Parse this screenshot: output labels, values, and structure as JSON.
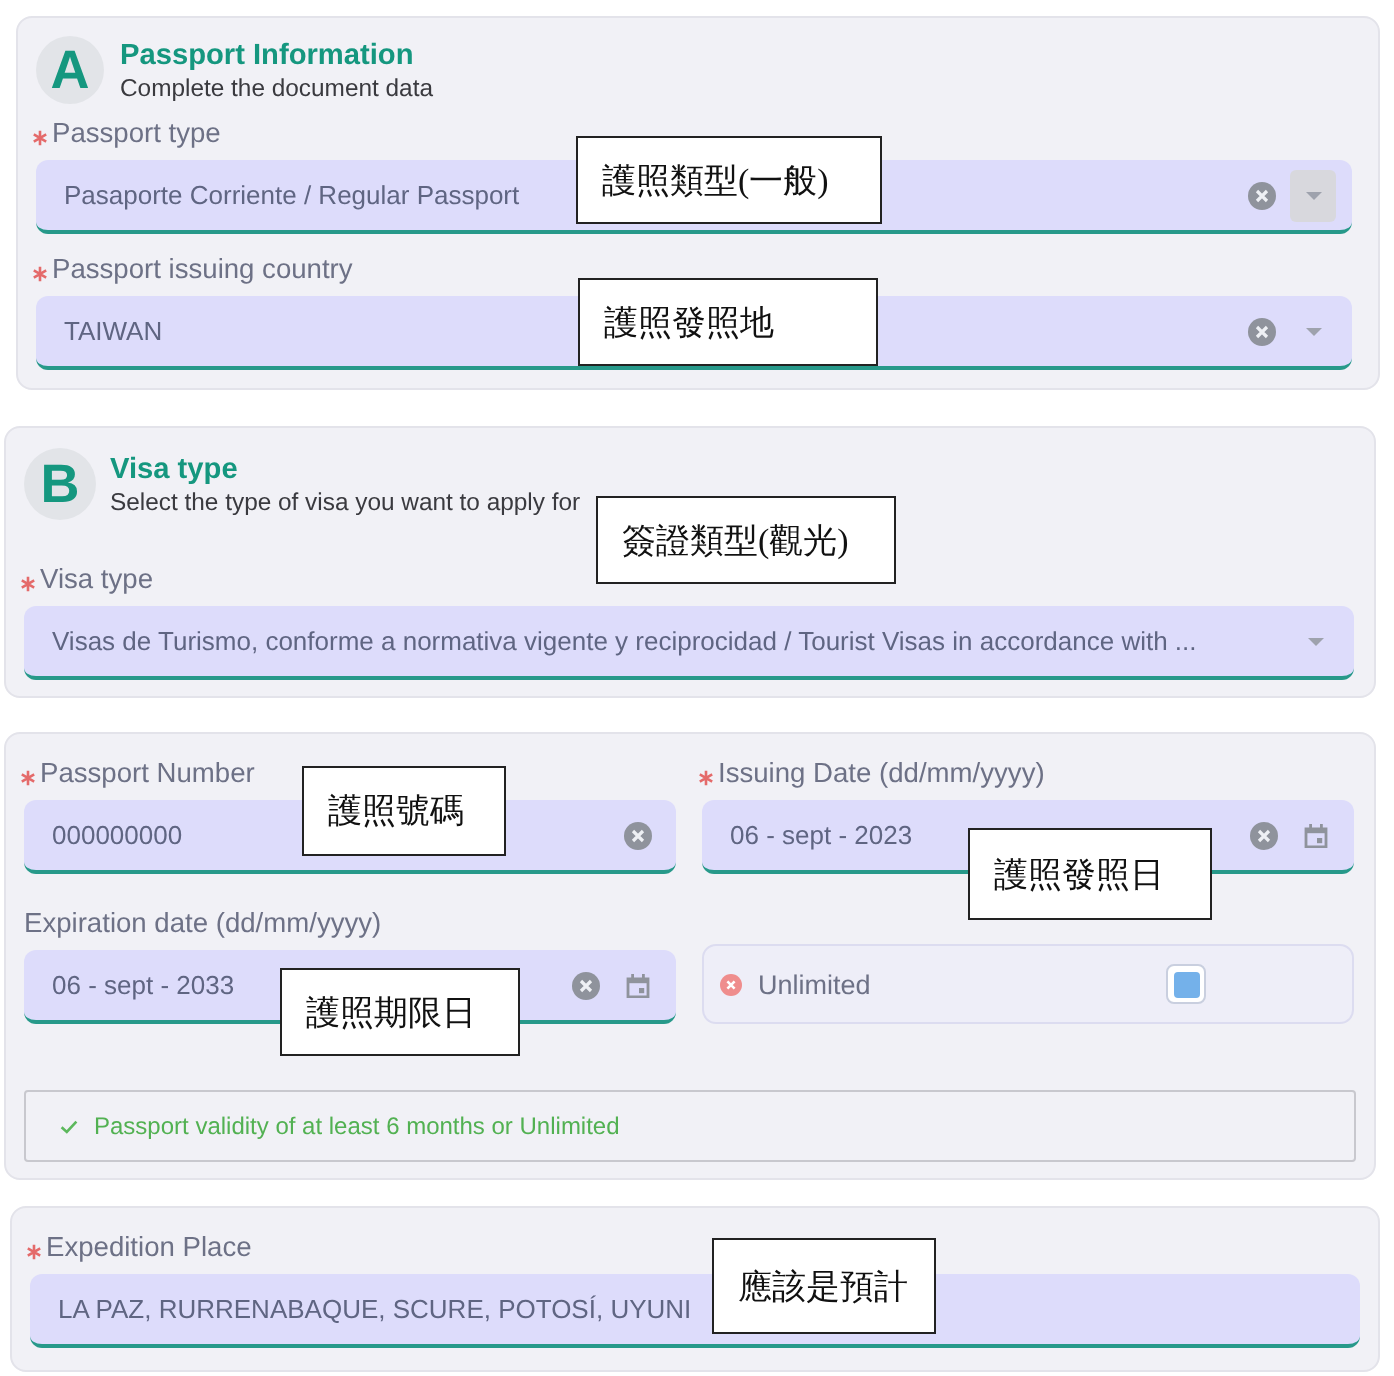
{
  "sections": [
    {
      "kind": "intro",
      "badge": "A",
      "title": "Passport Information",
      "subtitle": "Complete the document data",
      "fields": [
        {
          "kind": "select",
          "label": "Passport type",
          "required": true,
          "value": "Pasaporte Corriente / Regular Passport",
          "clearable": true,
          "caret_hovered": true
        },
        {
          "kind": "select",
          "label": "Passport issuing country",
          "required": true,
          "value": "TAIWAN",
          "clearable": true,
          "caret_hovered": false
        }
      ],
      "notes": [
        "護照類型(一般)",
        "護照發照地"
      ]
    },
    {
      "kind": "intro",
      "badge": "B",
      "title": "Visa type",
      "subtitle": "Select the type of visa you want to apply for",
      "fields": [
        {
          "kind": "select",
          "label": "Visa type",
          "required": true,
          "value": "Visas de Turismo, conforme a normativa vigente y reciprocidad / Tourist Visas in accordance with ...",
          "clearable": false,
          "caret_hovered": false
        }
      ],
      "notes": [
        "簽證類型(觀光)"
      ]
    },
    {
      "kind": "grid",
      "fields": [
        {
          "kind": "text",
          "label": "Passport Number",
          "required": true,
          "value": "000000000",
          "clearable": true
        },
        {
          "kind": "date",
          "label": "Issuing Date (dd/mm/yyyy)",
          "required": true,
          "value": "06 - sept - 2023",
          "clearable": true
        },
        {
          "kind": "date",
          "label": "Expiration date (dd/mm/yyyy)",
          "required": false,
          "value": "06 - sept - 2033",
          "clearable": true
        },
        {
          "kind": "toggle",
          "label": "Unlimited",
          "checked": false
        }
      ],
      "validation": {
        "text": "Passport validity of at least 6 months or Unlimited",
        "valid": true
      },
      "notes": [
        "護照號碼",
        "護照發照日",
        "護照期限日"
      ]
    },
    {
      "kind": "plain",
      "fields": [
        {
          "kind": "text",
          "label": "Expedition Place",
          "required": true,
          "value": "LA PAZ, RURRENABAQUE, SCURE, POTOSÍ, UYUNI",
          "clearable": false
        }
      ],
      "notes": [
        "應該是預計"
      ]
    }
  ]
}
